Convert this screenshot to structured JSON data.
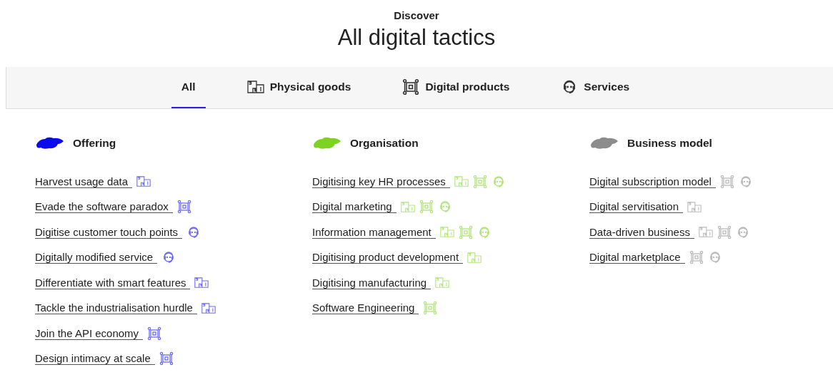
{
  "header": {
    "eyebrow": "Discover",
    "title": "All digital tactics"
  },
  "tabs": [
    {
      "label": "All",
      "kind": "all",
      "selected": true
    },
    {
      "label": "Physical goods",
      "kind": "physical",
      "selected": false
    },
    {
      "label": "Digital products",
      "kind": "digital",
      "selected": false
    },
    {
      "label": "Services",
      "kind": "service",
      "selected": false
    }
  ],
  "groups": [
    {
      "title": "Offering",
      "color": "#0a0af0",
      "items": [
        {
          "label": "Harvest usage data",
          "tags": [
            {
              "kind": "physical"
            }
          ]
        },
        {
          "label": "Evade the software paradox",
          "tags": [
            {
              "kind": "digital"
            }
          ]
        },
        {
          "label": "Digitise customer touch points",
          "tags": [
            {
              "kind": "service"
            }
          ]
        },
        {
          "label": "Digitally modified service",
          "tags": [
            {
              "kind": "service"
            }
          ]
        },
        {
          "label": "Differentiate with smart features",
          "tags": [
            {
              "kind": "physical"
            }
          ]
        },
        {
          "label": "Tackle the industrialisation hurdle",
          "tags": [
            {
              "kind": "physical"
            }
          ]
        },
        {
          "label": "Join the API economy",
          "tags": [
            {
              "kind": "digital"
            }
          ]
        },
        {
          "label": "Design intimacy at scale",
          "tags": [
            {
              "kind": "digital"
            }
          ]
        }
      ]
    },
    {
      "title": "Organisation",
      "color": "#7ed321",
      "items": [
        {
          "label": "Digitising key HR processes",
          "tags": [
            {
              "kind": "physical"
            },
            {
              "kind": "digital"
            },
            {
              "kind": "service"
            }
          ]
        },
        {
          "label": "Digital marketing",
          "tags": [
            {
              "kind": "physical"
            },
            {
              "kind": "digital"
            },
            {
              "kind": "service"
            }
          ]
        },
        {
          "label": "Information management",
          "tags": [
            {
              "kind": "physical"
            },
            {
              "kind": "digital"
            },
            {
              "kind": "service"
            }
          ]
        },
        {
          "label": "Digitising product development",
          "tags": [
            {
              "kind": "physical"
            }
          ]
        },
        {
          "label": "Digitising manufacturing",
          "tags": [
            {
              "kind": "physical"
            }
          ]
        },
        {
          "label": "Software Engineering",
          "tags": [
            {
              "kind": "digital"
            }
          ]
        }
      ]
    },
    {
      "title": "Business model",
      "color": "#8c8c8c",
      "items": [
        {
          "label": "Digital subscription model",
          "tags": [
            {
              "kind": "digital"
            },
            {
              "kind": "service"
            }
          ]
        },
        {
          "label": "Digital servitisation",
          "tags": [
            {
              "kind": "physical"
            }
          ]
        },
        {
          "label": "Data-driven business",
          "tags": [
            {
              "kind": "physical"
            },
            {
              "kind": "digital"
            },
            {
              "kind": "service"
            }
          ]
        },
        {
          "label": "Digital marketplace",
          "tags": [
            {
              "kind": "digital"
            },
            {
              "kind": "service"
            }
          ]
        }
      ]
    }
  ]
}
